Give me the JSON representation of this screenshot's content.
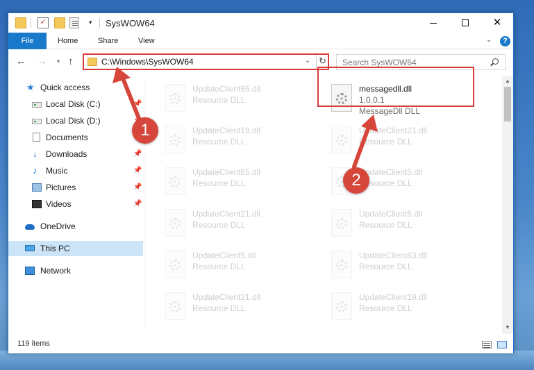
{
  "window": {
    "title": "SysWOW64"
  },
  "ribbon": {
    "tabs": [
      "File",
      "Home",
      "Share",
      "View"
    ],
    "help": "?"
  },
  "address": {
    "path": "C:\\Windows\\SysWOW64"
  },
  "search": {
    "placeholder": "Search SysWOW64"
  },
  "sidebar": {
    "items": [
      {
        "label": "Quick access",
        "icon": "star-icon"
      },
      {
        "label": "Local Disk (C:)",
        "icon": "drive-icon"
      },
      {
        "label": "Local Disk (D:)",
        "icon": "drive-icon"
      },
      {
        "label": "Documents",
        "icon": "documents-icon"
      },
      {
        "label": "Downloads",
        "icon": "downloads-icon"
      },
      {
        "label": "Music",
        "icon": "music-icon"
      },
      {
        "label": "Pictures",
        "icon": "pictures-icon"
      },
      {
        "label": "Videos",
        "icon": "videos-icon"
      },
      {
        "label": "OneDrive",
        "icon": "onedrive-icon"
      },
      {
        "label": "This PC",
        "icon": "this-pc-icon",
        "selected": true
      },
      {
        "label": "Network",
        "icon": "network-icon"
      }
    ]
  },
  "files": [
    {
      "name": "UpdateClient65.dll",
      "type": "Resource DLL"
    },
    {
      "name": "messagedll.dll",
      "version": "1.0.0.1",
      "description": "MessageDll DLL",
      "highlighted": true
    },
    {
      "name": "UpdateClient19.dll",
      "type": "Resource DLL"
    },
    {
      "name": "UpdateClient21.dll",
      "type": "Resource DLL"
    },
    {
      "name": "UpdateClient65.dll",
      "type": "Resource DLL"
    },
    {
      "name": "UpdateClient5.dll",
      "type": "Resource DLL"
    },
    {
      "name": "UpdateClient21.dll",
      "type": "Resource DLL"
    },
    {
      "name": "UpdateClient5.dll",
      "type": "Resource DLL"
    },
    {
      "name": "UpdateClient5.dll",
      "type": "Resource DLL"
    },
    {
      "name": "UpdateClient63.dll",
      "type": "Resource DLL"
    },
    {
      "name": "UpdateClient21.dll",
      "type": "Resource DLL"
    },
    {
      "name": "UpdateClient19.dll",
      "type": "Resource DLL"
    }
  ],
  "status": {
    "items_count": "119 items"
  },
  "callouts": [
    "1",
    "2"
  ],
  "colors": {
    "accent": "#1979ca",
    "highlight": "#d93b3b",
    "callout": "#d7463b",
    "selection": "#cce4f7"
  }
}
